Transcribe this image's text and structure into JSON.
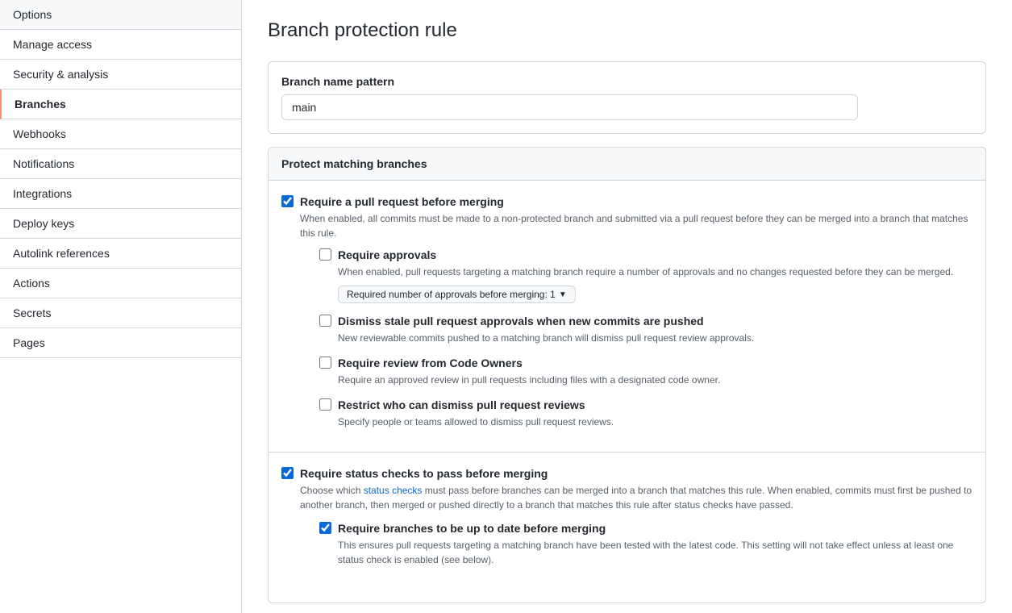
{
  "page": {
    "title": "Branch protection rule"
  },
  "sidebar": {
    "items": [
      {
        "id": "options",
        "label": "Options",
        "active": false
      },
      {
        "id": "manage-access",
        "label": "Manage access",
        "active": false
      },
      {
        "id": "security-analysis",
        "label": "Security & analysis",
        "active": false
      },
      {
        "id": "branches",
        "label": "Branches",
        "active": true
      },
      {
        "id": "webhooks",
        "label": "Webhooks",
        "active": false
      },
      {
        "id": "notifications",
        "label": "Notifications",
        "active": false
      },
      {
        "id": "integrations",
        "label": "Integrations",
        "active": false
      },
      {
        "id": "deploy-keys",
        "label": "Deploy keys",
        "active": false
      },
      {
        "id": "autolink-references",
        "label": "Autolink references",
        "active": false
      },
      {
        "id": "actions",
        "label": "Actions",
        "active": false
      },
      {
        "id": "secrets",
        "label": "Secrets",
        "active": false
      },
      {
        "id": "pages",
        "label": "Pages",
        "active": false
      }
    ]
  },
  "main": {
    "branch_name_pattern_label": "Branch name pattern",
    "branch_name_value": "main",
    "protect_section_title": "Protect matching branches",
    "require_pr_label": "Require a pull request before merging",
    "require_pr_desc": "When enabled, all commits must be made to a non-protected branch and submitted via a pull request before they can be merged into a branch that matches this rule.",
    "require_pr_checked": true,
    "require_approvals_label": "Require approvals",
    "require_approvals_desc": "When enabled, pull requests targeting a matching branch require a number of approvals and no changes requested before they can be merged.",
    "require_approvals_checked": false,
    "approvals_dropdown_label": "Required number of approvals before merging: 1",
    "dismiss_stale_label": "Dismiss stale pull request approvals when new commits are pushed",
    "dismiss_stale_desc": "New reviewable commits pushed to a matching branch will dismiss pull request review approvals.",
    "dismiss_stale_checked": false,
    "require_code_owners_label": "Require review from Code Owners",
    "require_code_owners_desc": "Require an approved review in pull requests including files with a designated code owner.",
    "require_code_owners_checked": false,
    "restrict_dismiss_label": "Restrict who can dismiss pull request reviews",
    "restrict_dismiss_desc": "Specify people or teams allowed to dismiss pull request reviews.",
    "restrict_dismiss_checked": false,
    "require_status_checks_label": "Require status checks to pass before merging",
    "require_status_checks_desc_before": "Choose which ",
    "require_status_checks_link": "status checks",
    "require_status_checks_desc_after": " must pass before branches can be merged into a branch that matches this rule. When enabled, commits must first be pushed to another branch, then merged or pushed directly to a branch that matches this rule after status checks have passed.",
    "require_status_checks_checked": true,
    "require_branches_uptodate_label": "Require branches to be up to date before merging",
    "require_branches_uptodate_desc": "This ensures pull requests targeting a matching branch have been tested with the latest code. This setting will not take effect unless at least one status check is enabled (see below).",
    "require_branches_uptodate_checked": true
  }
}
